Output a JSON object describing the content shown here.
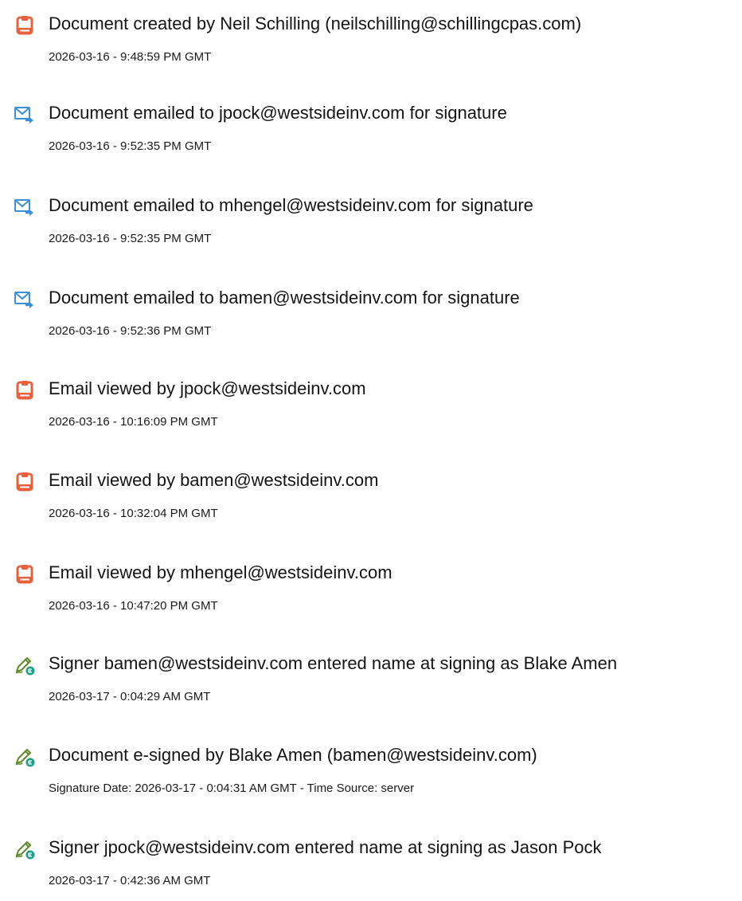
{
  "events": [
    {
      "icon": "document-created-icon",
      "title": "Document created by Neil Schilling (neilschilling@schillingcpas.com)",
      "timestamp": "2026-03-16 - 9:48:59 PM GMT"
    },
    {
      "icon": "email-sent-icon",
      "title": "Document emailed to jpock@westsideinv.com for signature",
      "timestamp": "2026-03-16 - 9:52:35 PM GMT"
    },
    {
      "icon": "email-sent-icon",
      "title": "Document emailed to mhengel@westsideinv.com for signature",
      "timestamp": "2026-03-16 - 9:52:35 PM GMT"
    },
    {
      "icon": "email-sent-icon",
      "title": "Document emailed to bamen@westsideinv.com for signature",
      "timestamp": "2026-03-16 - 9:52:36 PM GMT"
    },
    {
      "icon": "document-viewed-icon",
      "title": "Email viewed by jpock@westsideinv.com",
      "timestamp": "2026-03-16 - 10:16:09 PM GMT"
    },
    {
      "icon": "document-viewed-icon",
      "title": "Email viewed by bamen@westsideinv.com",
      "timestamp": "2026-03-16 - 10:32:04 PM GMT"
    },
    {
      "icon": "document-viewed-icon",
      "title": "Email viewed by mhengel@westsideinv.com",
      "timestamp": "2026-03-16 - 10:47:20 PM GMT"
    },
    {
      "icon": "e-sign-pen-icon",
      "title": "Signer bamen@westsideinv.com entered name at signing as Blake Amen",
      "timestamp": "2026-03-17 - 0:04:29 AM GMT"
    },
    {
      "icon": "e-sign-pen-icon",
      "title": "Document e-signed by Blake Amen (bamen@westsideinv.com)",
      "timestamp": "Signature Date: 2026-03-17 - 0:04:31 AM GMT - Time Source: server"
    },
    {
      "icon": "e-sign-pen-icon",
      "title": "Signer jpock@westsideinv.com entered name at signing as Jason Pock",
      "timestamp": "2026-03-17 - 0:42:36 AM GMT"
    }
  ],
  "colors": {
    "document_icon": "#e8603c",
    "email_icon": "#3d8fd9",
    "sign_icon_pen": "#5f8a2c",
    "sign_icon_badge": "#1aa089",
    "text": "#141414"
  }
}
